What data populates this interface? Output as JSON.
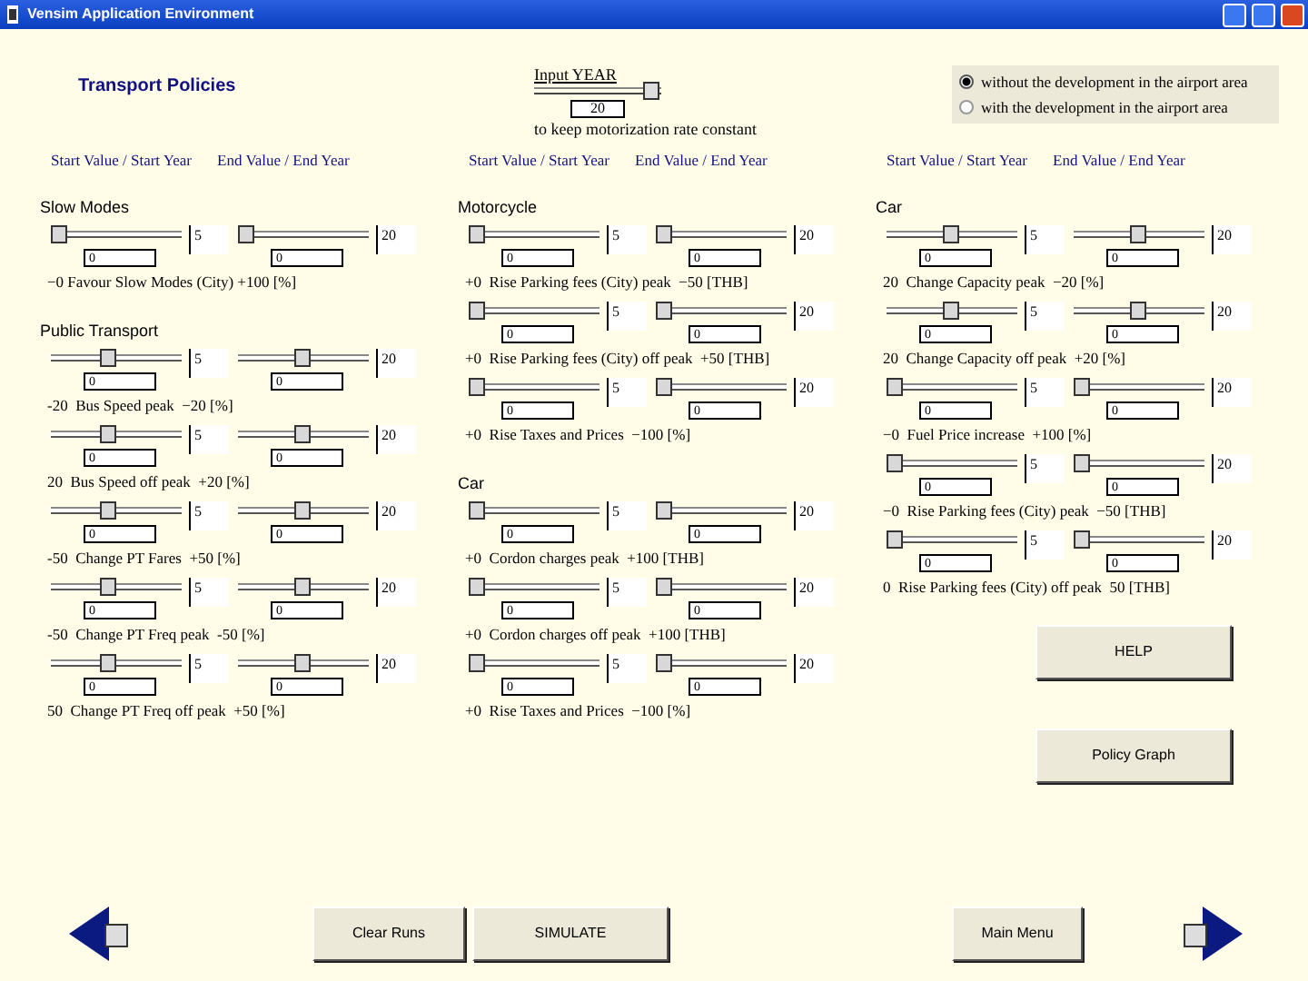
{
  "window": {
    "title": "Vensim Application Environment"
  },
  "page_title": "Transport Policies",
  "year_input": {
    "label": "Input  YEAR",
    "level": 1,
    "value": "20",
    "note": "to keep motorization rate constant"
  },
  "scenario_options": [
    {
      "label": "without the development in the airport area",
      "selected": true
    },
    {
      "label": "with the development in the airport area",
      "selected": false
    }
  ],
  "columns": [
    {
      "headers": [
        "Start Value / Start Year",
        "End Value / End Year"
      ],
      "groups": [
        {
          "heading": "Slow Modes",
          "rows": [
            {
              "start": {
                "level": 0,
                "value": "0",
                "year": "5"
              },
              "end": {
                "level": 0,
                "value": "0",
                "year": "20"
              },
              "caption": "−0 Favour Slow Modes (City) +100 [%]"
            }
          ]
        },
        {
          "heading": "Public Transport",
          "rows": [
            {
              "start": {
                "level": 0.45,
                "value": "0",
                "year": "5"
              },
              "end": {
                "level": 0.5,
                "value": "0",
                "year": "20"
              },
              "caption": "-20  Bus Speed peak  −20 [%]"
            },
            {
              "start": {
                "level": 0.45,
                "value": "0",
                "year": "5"
              },
              "end": {
                "level": 0.5,
                "value": "0",
                "year": "20"
              },
              "caption": "20  Bus Speed off peak  +20 [%]"
            },
            {
              "start": {
                "level": 0.45,
                "value": "0",
                "year": "5"
              },
              "end": {
                "level": 0.5,
                "value": "0",
                "year": "20"
              },
              "caption": "-50  Change PT Fares  +50 [%]"
            },
            {
              "start": {
                "level": 0.45,
                "value": "0",
                "year": "5"
              },
              "end": {
                "level": 0.5,
                "value": "0",
                "year": "20"
              },
              "caption": "-50  Change PT Freq peak  -50 [%]"
            },
            {
              "start": {
                "level": 0.45,
                "value": "0",
                "year": "5"
              },
              "end": {
                "level": 0.5,
                "value": "0",
                "year": "20"
              },
              "caption": "50  Change PT Freq off peak  +50 [%]"
            }
          ]
        }
      ]
    },
    {
      "headers": [
        "Start Value / Start Year",
        "End Value / End Year"
      ],
      "groups": [
        {
          "heading": "Motorcycle",
          "rows": [
            {
              "start": {
                "level": 0,
                "value": "0",
                "year": "5"
              },
              "end": {
                "level": 0,
                "value": "0",
                "year": "20"
              },
              "caption": "+0  Rise Parking fees (City) peak  −50 [THB]"
            },
            {
              "start": {
                "level": 0,
                "value": "0",
                "year": "5"
              },
              "end": {
                "level": 0,
                "value": "0",
                "year": "20"
              },
              "caption": "+0  Rise Parking fees (City) off peak  +50 [THB]"
            },
            {
              "start": {
                "level": 0,
                "value": "0",
                "year": "5"
              },
              "end": {
                "level": 0,
                "value": "0",
                "year": "20"
              },
              "caption": "+0  Rise Taxes and Prices  −100 [%]"
            }
          ]
        },
        {
          "heading": "Car",
          "rows": [
            {
              "start": {
                "level": 0,
                "value": "0",
                "year": "5"
              },
              "end": {
                "level": 0,
                "value": "0",
                "year": "20"
              },
              "caption": "+0  Cordon charges peak  +100 [THB]"
            },
            {
              "start": {
                "level": 0,
                "value": "0",
                "year": "5"
              },
              "end": {
                "level": 0,
                "value": "0",
                "year": "20"
              },
              "caption": "+0  Cordon charges off peak  +100 [THB]"
            },
            {
              "start": {
                "level": 0,
                "value": "0",
                "year": "5"
              },
              "end": {
                "level": 0,
                "value": "0",
                "year": "20"
              },
              "caption": "+0  Rise Taxes and Prices  −100 [%]"
            }
          ]
        }
      ]
    },
    {
      "headers": [
        "Start Value / Start Year",
        "End Value / End Year"
      ],
      "groups": [
        {
          "heading": "Car",
          "rows": [
            {
              "start": {
                "level": 0.5,
                "value": "0",
                "year": "5"
              },
              "end": {
                "level": 0.5,
                "value": "0",
                "year": "20"
              },
              "caption": "20  Change Capacity peak  −20 [%]"
            },
            {
              "start": {
                "level": 0.5,
                "value": "0",
                "year": "5"
              },
              "end": {
                "level": 0.5,
                "value": "0",
                "year": "20"
              },
              "caption": "20  Change Capacity off peak  +20 [%]"
            },
            {
              "start": {
                "level": 0,
                "value": "0",
                "year": "5"
              },
              "end": {
                "level": 0,
                "value": "0",
                "year": "20"
              },
              "caption": "−0  Fuel Price increase  +100 [%]"
            },
            {
              "start": {
                "level": 0,
                "value": "0",
                "year": "5"
              },
              "end": {
                "level": 0,
                "value": "0",
                "year": "20"
              },
              "caption": "−0  Rise Parking fees (City) peak  −50 [THB]"
            },
            {
              "start": {
                "level": 0,
                "value": "0",
                "year": "5"
              },
              "end": {
                "level": 0,
                "value": "0",
                "year": "20"
              },
              "caption": "0  Rise Parking fees (City) off peak  50 [THB]"
            }
          ]
        }
      ]
    }
  ],
  "side_buttons": [
    "HELP",
    "Policy Graph"
  ],
  "bottom_buttons": [
    "Clear Runs",
    "SIMULATE",
    "Main Menu"
  ]
}
